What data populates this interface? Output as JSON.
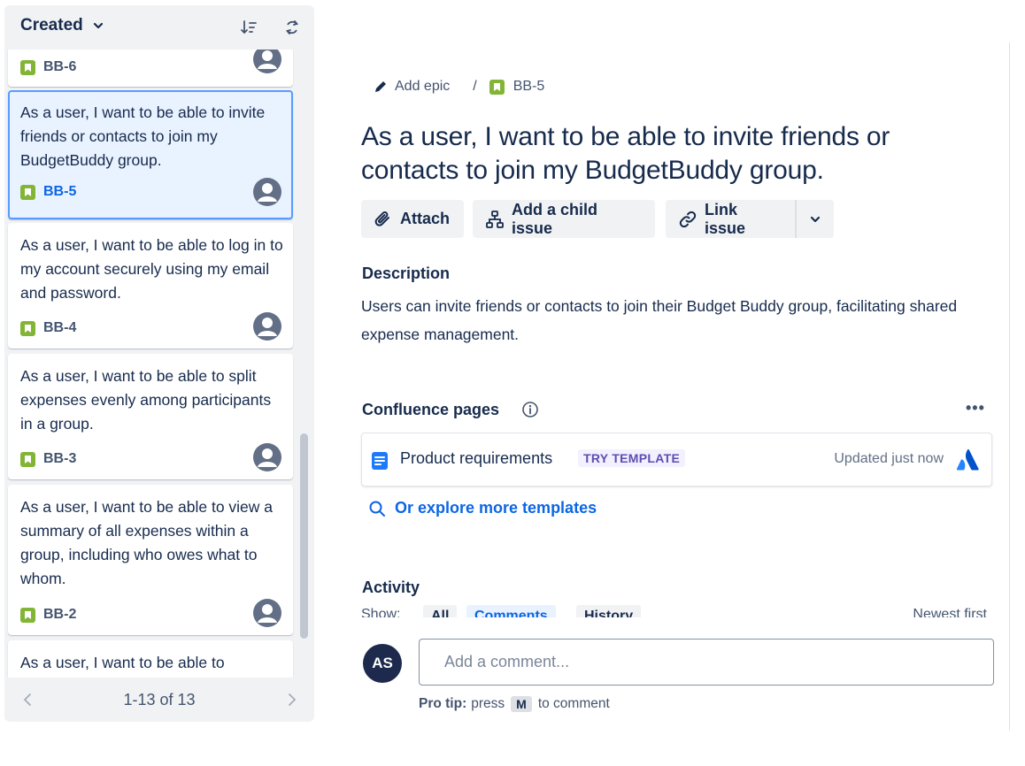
{
  "sidebar": {
    "sort_label": "Created",
    "icons": {
      "sort": "sort-order-icon",
      "refresh": "refresh-icon",
      "story": "story-icon",
      "avatar": "unassigned-avatar-icon"
    },
    "cards": [
      {
        "text": "",
        "key": "BB-6"
      },
      {
        "text": "As a user, I want to be able to invite friends or contacts to join my BudgetBuddy group.",
        "key": "BB-5"
      },
      {
        "text": "As a user, I want to be able to log in to my account securely using my email and password.",
        "key": "BB-4"
      },
      {
        "text": "As a user, I want to be able to split expenses evenly among participants in a group.",
        "key": "BB-3"
      },
      {
        "text": "As a user, I want to be able to view a summary of all expenses within a group, including who owes what to whom.",
        "key": "BB-2"
      },
      {
        "text": "As a user, I want to be able to",
        "key": ""
      }
    ],
    "pagination": "1-13 of 13"
  },
  "breadcrumb": {
    "epic_label": "Add epic",
    "separator": "/",
    "issue_key": "BB-5"
  },
  "issue": {
    "title": "As a user, I want to be able to invite friends or contacts to join my BudgetBuddy group.",
    "actions": {
      "attach": "Attach",
      "child": "Add a child issue",
      "link": "Link issue"
    }
  },
  "description": {
    "heading": "Description",
    "text": "Users can invite friends or contacts to join their Budget Buddy group, facilitating shared expense management."
  },
  "confluence": {
    "heading": "Confluence pages",
    "more": "•••",
    "page_title": "Product requirements",
    "badge": "TRY TEMPLATE",
    "updated": "Updated just now",
    "explore": "Or explore more templates"
  },
  "activity": {
    "heading": "Activity",
    "show_label": "Show:",
    "filters": [
      "All",
      "Comments",
      "History"
    ],
    "sort": "Newest first"
  },
  "comment": {
    "avatar_initials": "AS",
    "placeholder": "Add a comment...",
    "pro_tip_label": "Pro tip:",
    "pro_tip_before": "press",
    "pro_tip_key": "M",
    "pro_tip_after": "to comment"
  },
  "colors": {
    "accent": "#0c66e4",
    "story_green": "#82b536",
    "selected_bg": "#e9f2ff",
    "selected_border": "#579dff",
    "badge_purple": "#5e4db2"
  }
}
